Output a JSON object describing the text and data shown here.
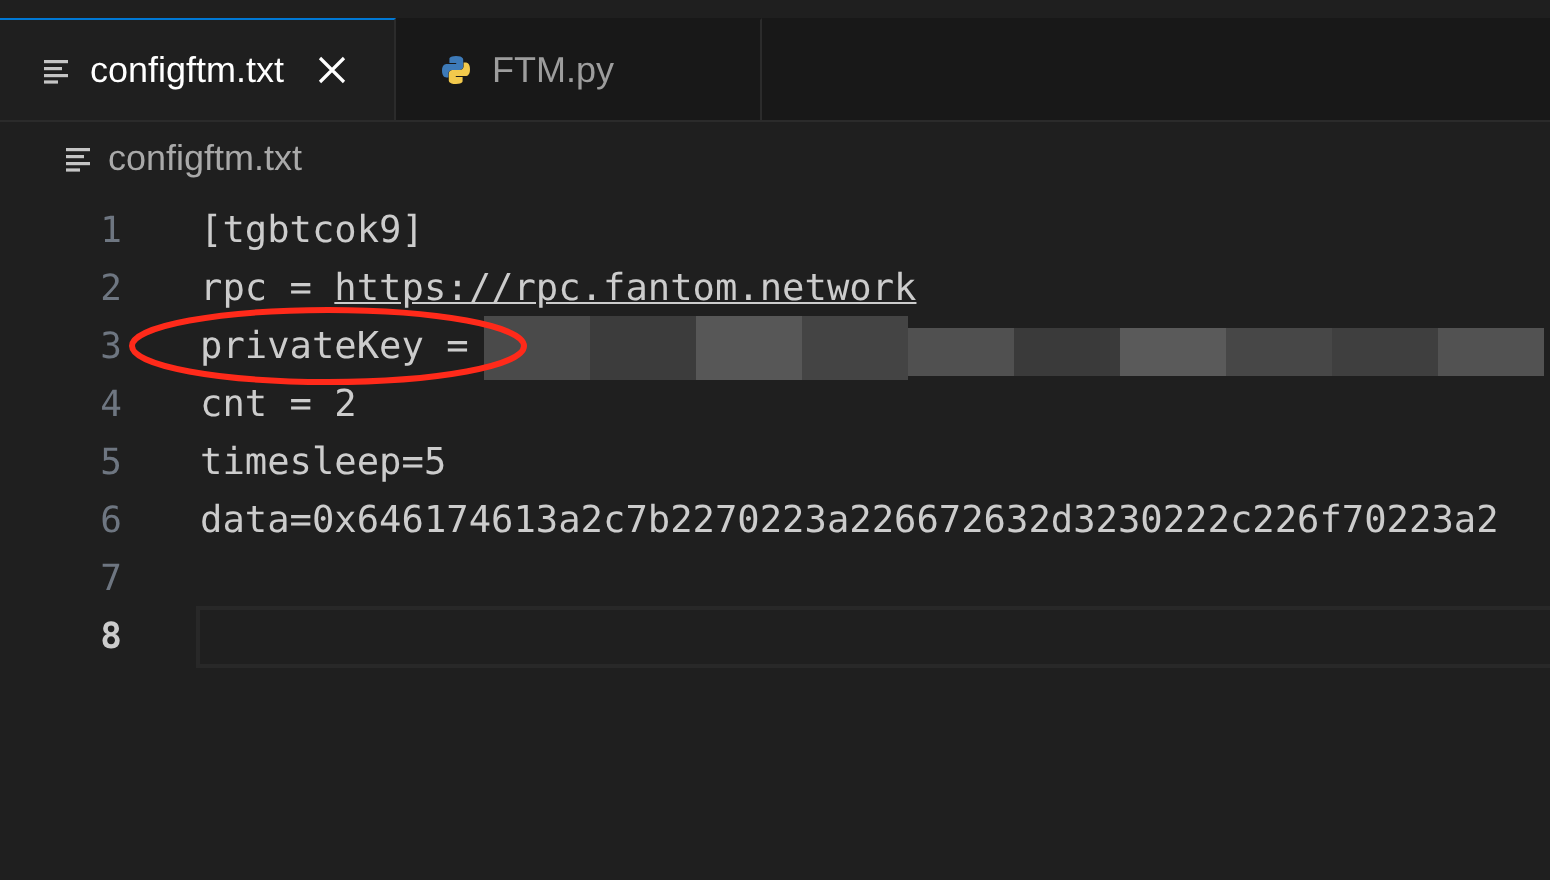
{
  "tabs": [
    {
      "label": "configftm.txt",
      "kind": "text",
      "selected": true,
      "closable": true
    },
    {
      "label": "FTM.py",
      "kind": "script",
      "selected": false,
      "closable": false
    }
  ],
  "breadcrumb": "configftm.txt",
  "lines": [
    {
      "number": "1",
      "text": "[tgbtcok9]",
      "current": false
    },
    {
      "number": "2",
      "text": "rpc = ",
      "link": "https://rpc.fantom.network",
      "current": false
    },
    {
      "number": "3",
      "text": "privateKey =",
      "redacted": true,
      "circled": true,
      "current": false
    },
    {
      "number": "4",
      "text": "cnt = 2",
      "current": false
    },
    {
      "number": "5",
      "text": "timesleep=5",
      "current": false
    },
    {
      "number": "6",
      "text": "data=0x646174613a2c7b2270223a226672632d3230222c226f70223a2",
      "current": false
    },
    {
      "number": "7",
      "current": false
    },
    {
      "number": "8",
      "current": true
    }
  ]
}
